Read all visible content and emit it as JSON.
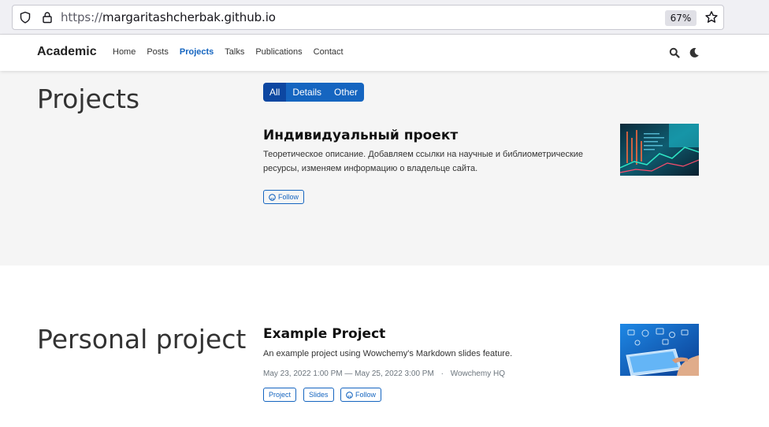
{
  "browser": {
    "url_scheme": "https://",
    "url_host": "margaritashcherbak.github.io",
    "zoom": "67%",
    "icons": [
      "shield-icon",
      "lock-icon",
      "star-icon"
    ]
  },
  "navbar": {
    "brand": "Academic",
    "items": [
      {
        "label": "Home",
        "active": false
      },
      {
        "label": "Posts",
        "active": false
      },
      {
        "label": "Projects",
        "active": true
      },
      {
        "label": "Talks",
        "active": false
      },
      {
        "label": "Publications",
        "active": false
      },
      {
        "label": "Contact",
        "active": false
      }
    ],
    "icons": [
      "search-icon",
      "moon-icon"
    ]
  },
  "projects_section": {
    "title": "Projects",
    "filters": [
      {
        "label": "All",
        "active": true
      },
      {
        "label": "Details",
        "active": false
      },
      {
        "label": "Other",
        "active": false
      }
    ],
    "item": {
      "title": "Индивидуальный проект",
      "description": "Теоретическое описание. Добавляем ссылки на научные и библиометрические ресурсы, изменяем информацию о владельце сайта.",
      "follow_label": "Follow"
    }
  },
  "personal_section": {
    "title": "Personal project",
    "item": {
      "title": "Example Project",
      "description": "An example project using Wowchemy's Markdown slides feature.",
      "date_range": "May 23, 2022 1:00 PM — May 25, 2022 3:00 PM",
      "separator": "·",
      "location": "Wowchemy HQ",
      "tags": [
        "Project",
        "Slides"
      ],
      "follow_label": "Follow"
    }
  },
  "colors": {
    "accent": "#1565c0",
    "accent_active": "#0d47a1",
    "section_bg": "#f5f5f5"
  }
}
